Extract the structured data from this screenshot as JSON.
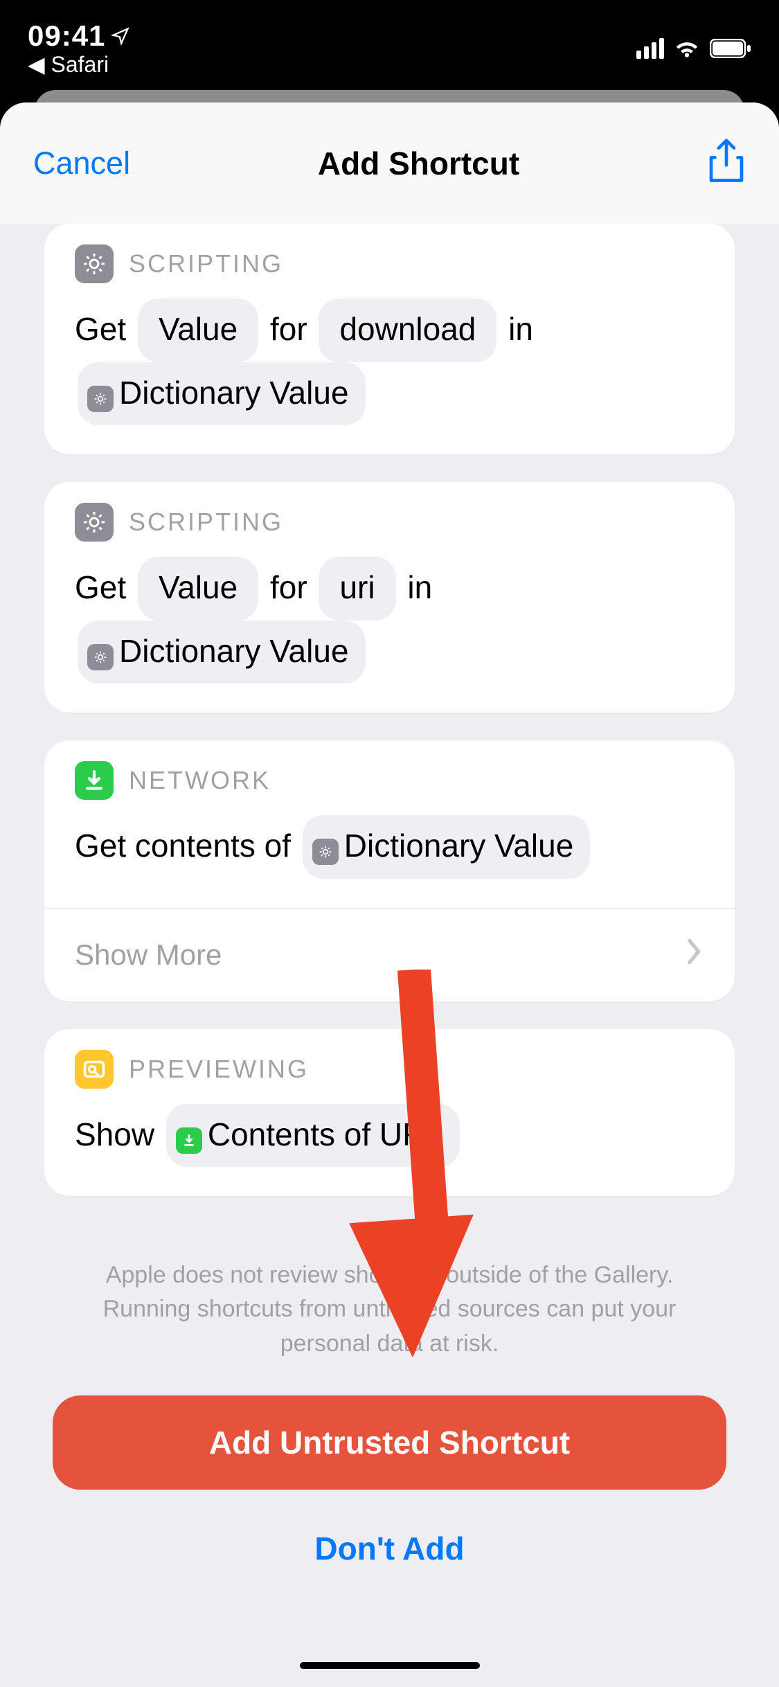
{
  "status": {
    "time": "09:41",
    "back_app": "◀ Safari"
  },
  "nav": {
    "cancel": "Cancel",
    "title": "Add Shortcut"
  },
  "cards": [
    {
      "category": "SCRIPTING",
      "parts": {
        "get": "Get",
        "for": "for",
        "in": "in",
        "val": "Value",
        "key": "download",
        "dict": "Dictionary Value"
      }
    },
    {
      "category": "SCRIPTING",
      "parts": {
        "get": "Get",
        "for": "for",
        "in": "in",
        "val": "Value",
        "key": "uri",
        "dict": "Dictionary Value"
      }
    },
    {
      "category": "NETWORK",
      "parts": {
        "prefix": "Get contents of",
        "dict": "Dictionary Value"
      },
      "show_more": "Show More"
    },
    {
      "category": "PREVIEWING",
      "parts": {
        "show": "Show",
        "obj": "Contents of URL"
      }
    }
  ],
  "warning_text": "Apple does not review shortcuts outside of the Gallery. Running shortcuts from untrusted sources can put your personal data at risk.",
  "buttons": {
    "primary": "Add Untrusted Shortcut",
    "secondary": "Don't Add"
  }
}
